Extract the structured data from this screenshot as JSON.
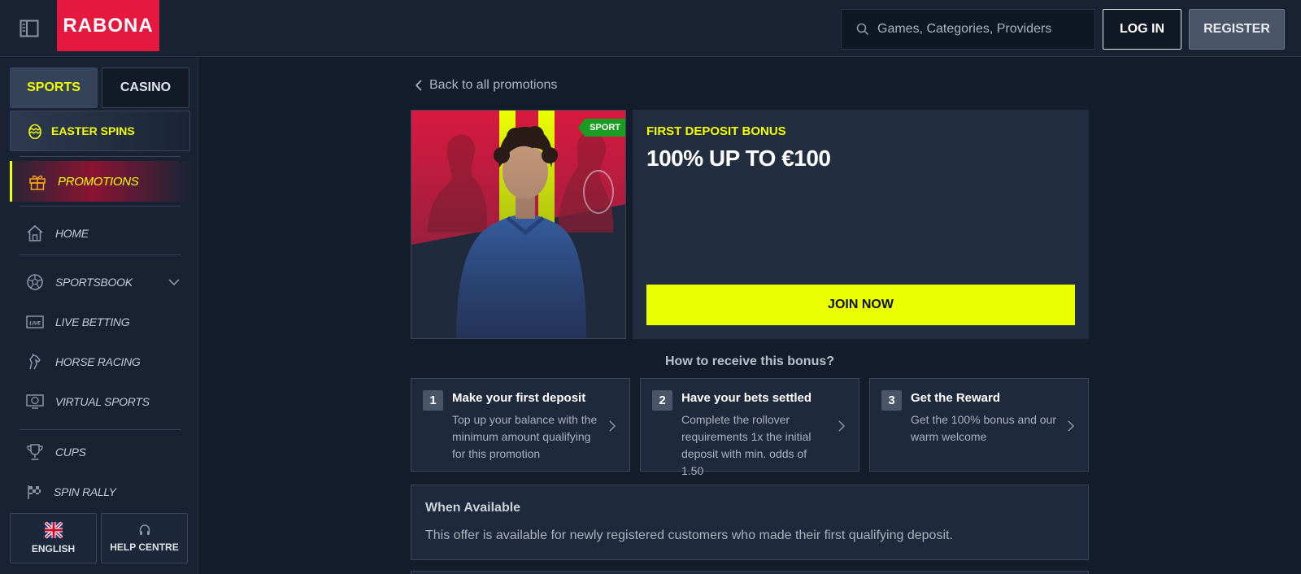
{
  "header": {
    "logo_text": "RABONA",
    "search_placeholder": "Games, Categories, Providers",
    "login_label": "LOG IN",
    "register_label": "REGISTER"
  },
  "sidebar": {
    "mode_tabs": [
      {
        "label": "SPORTS",
        "active": true
      },
      {
        "label": "CASINO",
        "active": false
      }
    ],
    "easter_label": "EASTER SPINS",
    "promotions_label": "PROMOTIONS",
    "items": [
      {
        "label": "HOME",
        "icon": "home-icon"
      },
      {
        "label": "SPORTSBOOK",
        "icon": "football-icon"
      },
      {
        "label": "LIVE BETTING",
        "icon": "live-icon"
      },
      {
        "label": "HORSE RACING",
        "icon": "horse-icon"
      },
      {
        "label": "VIRTUAL SPORTS",
        "icon": "virtual-sports-icon"
      },
      {
        "label": "CUPS",
        "icon": "trophy-icon"
      },
      {
        "label": "SPIN RALLY",
        "icon": "checkered-flag-icon"
      }
    ],
    "language_label": "ENGLISH",
    "help_label": "HELP CENTRE"
  },
  "main": {
    "back_label": "Back to all promotions",
    "tag_label": "SPORT",
    "promo_subtitle": "FIRST DEPOSIT BONUS",
    "promo_title": "100% UP TO €100",
    "join_label": "JOIN NOW",
    "how_title": "How to receive this bonus?",
    "steps": [
      {
        "num": "1",
        "title": "Make your first deposit",
        "desc": "Top up your balance with the minimum amount qualifying for this promotion"
      },
      {
        "num": "2",
        "title": "Have your bets settled",
        "desc": "Complete the rollover requirements 1x the initial deposit with min. odds of 1.50"
      },
      {
        "num": "3",
        "title": "Get the Reward",
        "desc": "Get the 100% bonus and our warm welcome"
      }
    ],
    "available_title": "When Available",
    "available_text": "This offer is available for newly registered customers who made their first qualifying deposit."
  },
  "colors": {
    "accent_yellow": "#f2ff00",
    "brand_red": "#e5183f",
    "background": "#141d2b",
    "sport_tag_green": "#1a9c22"
  }
}
